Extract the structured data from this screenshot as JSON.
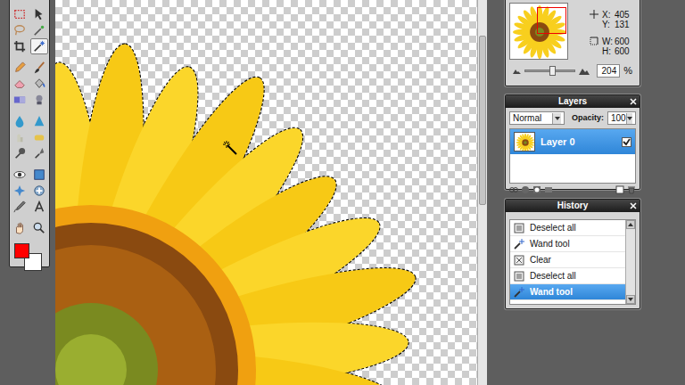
{
  "tools": [
    {
      "selected": false
    },
    {
      "selected": false
    },
    {
      "selected": false
    },
    {
      "selected": false
    },
    {
      "selected": false
    },
    {
      "selected": true
    },
    {
      "selected": false
    },
    {
      "selected": false
    },
    {
      "selected": false
    },
    {
      "selected": false
    },
    {
      "selected": false
    },
    {
      "selected": false
    },
    {
      "selected": false
    },
    {
      "selected": false
    },
    {
      "selected": false
    },
    {
      "selected": false
    },
    {
      "selected": false
    },
    {
      "selected": false
    },
    {
      "selected": false
    },
    {
      "selected": false
    },
    {
      "selected": false
    },
    {
      "selected": false
    },
    {
      "selected": false
    },
    {
      "selected": false
    },
    {
      "selected": false
    },
    {
      "selected": false
    }
  ],
  "colors": {
    "foreground": "#ff0000",
    "background": "#ffffff"
  },
  "navigator": {
    "x_label": "X:",
    "x": "405",
    "y_label": "Y:",
    "y": "131",
    "w_label": "W:",
    "w": "600",
    "h_label": "H:",
    "h": "600",
    "zoom": "204",
    "zoom_unit": "%",
    "zoom_level": 0.55
  },
  "layers": {
    "title": "Layers",
    "blend": "Normal",
    "opacity_label": "Opacity:",
    "opacity": "100",
    "items": [
      {
        "name": "Layer 0",
        "selected": true,
        "visible": true
      }
    ]
  },
  "history": {
    "title": "History",
    "items": [
      {
        "label": "Deselect all",
        "kind": "deselect",
        "selected": false
      },
      {
        "label": "Wand tool",
        "kind": "wand",
        "selected": false
      },
      {
        "label": "Clear",
        "kind": "clear",
        "selected": false
      },
      {
        "label": "Deselect all",
        "kind": "deselect",
        "selected": false
      },
      {
        "label": "Wand tool",
        "kind": "wand",
        "selected": true
      }
    ]
  }
}
